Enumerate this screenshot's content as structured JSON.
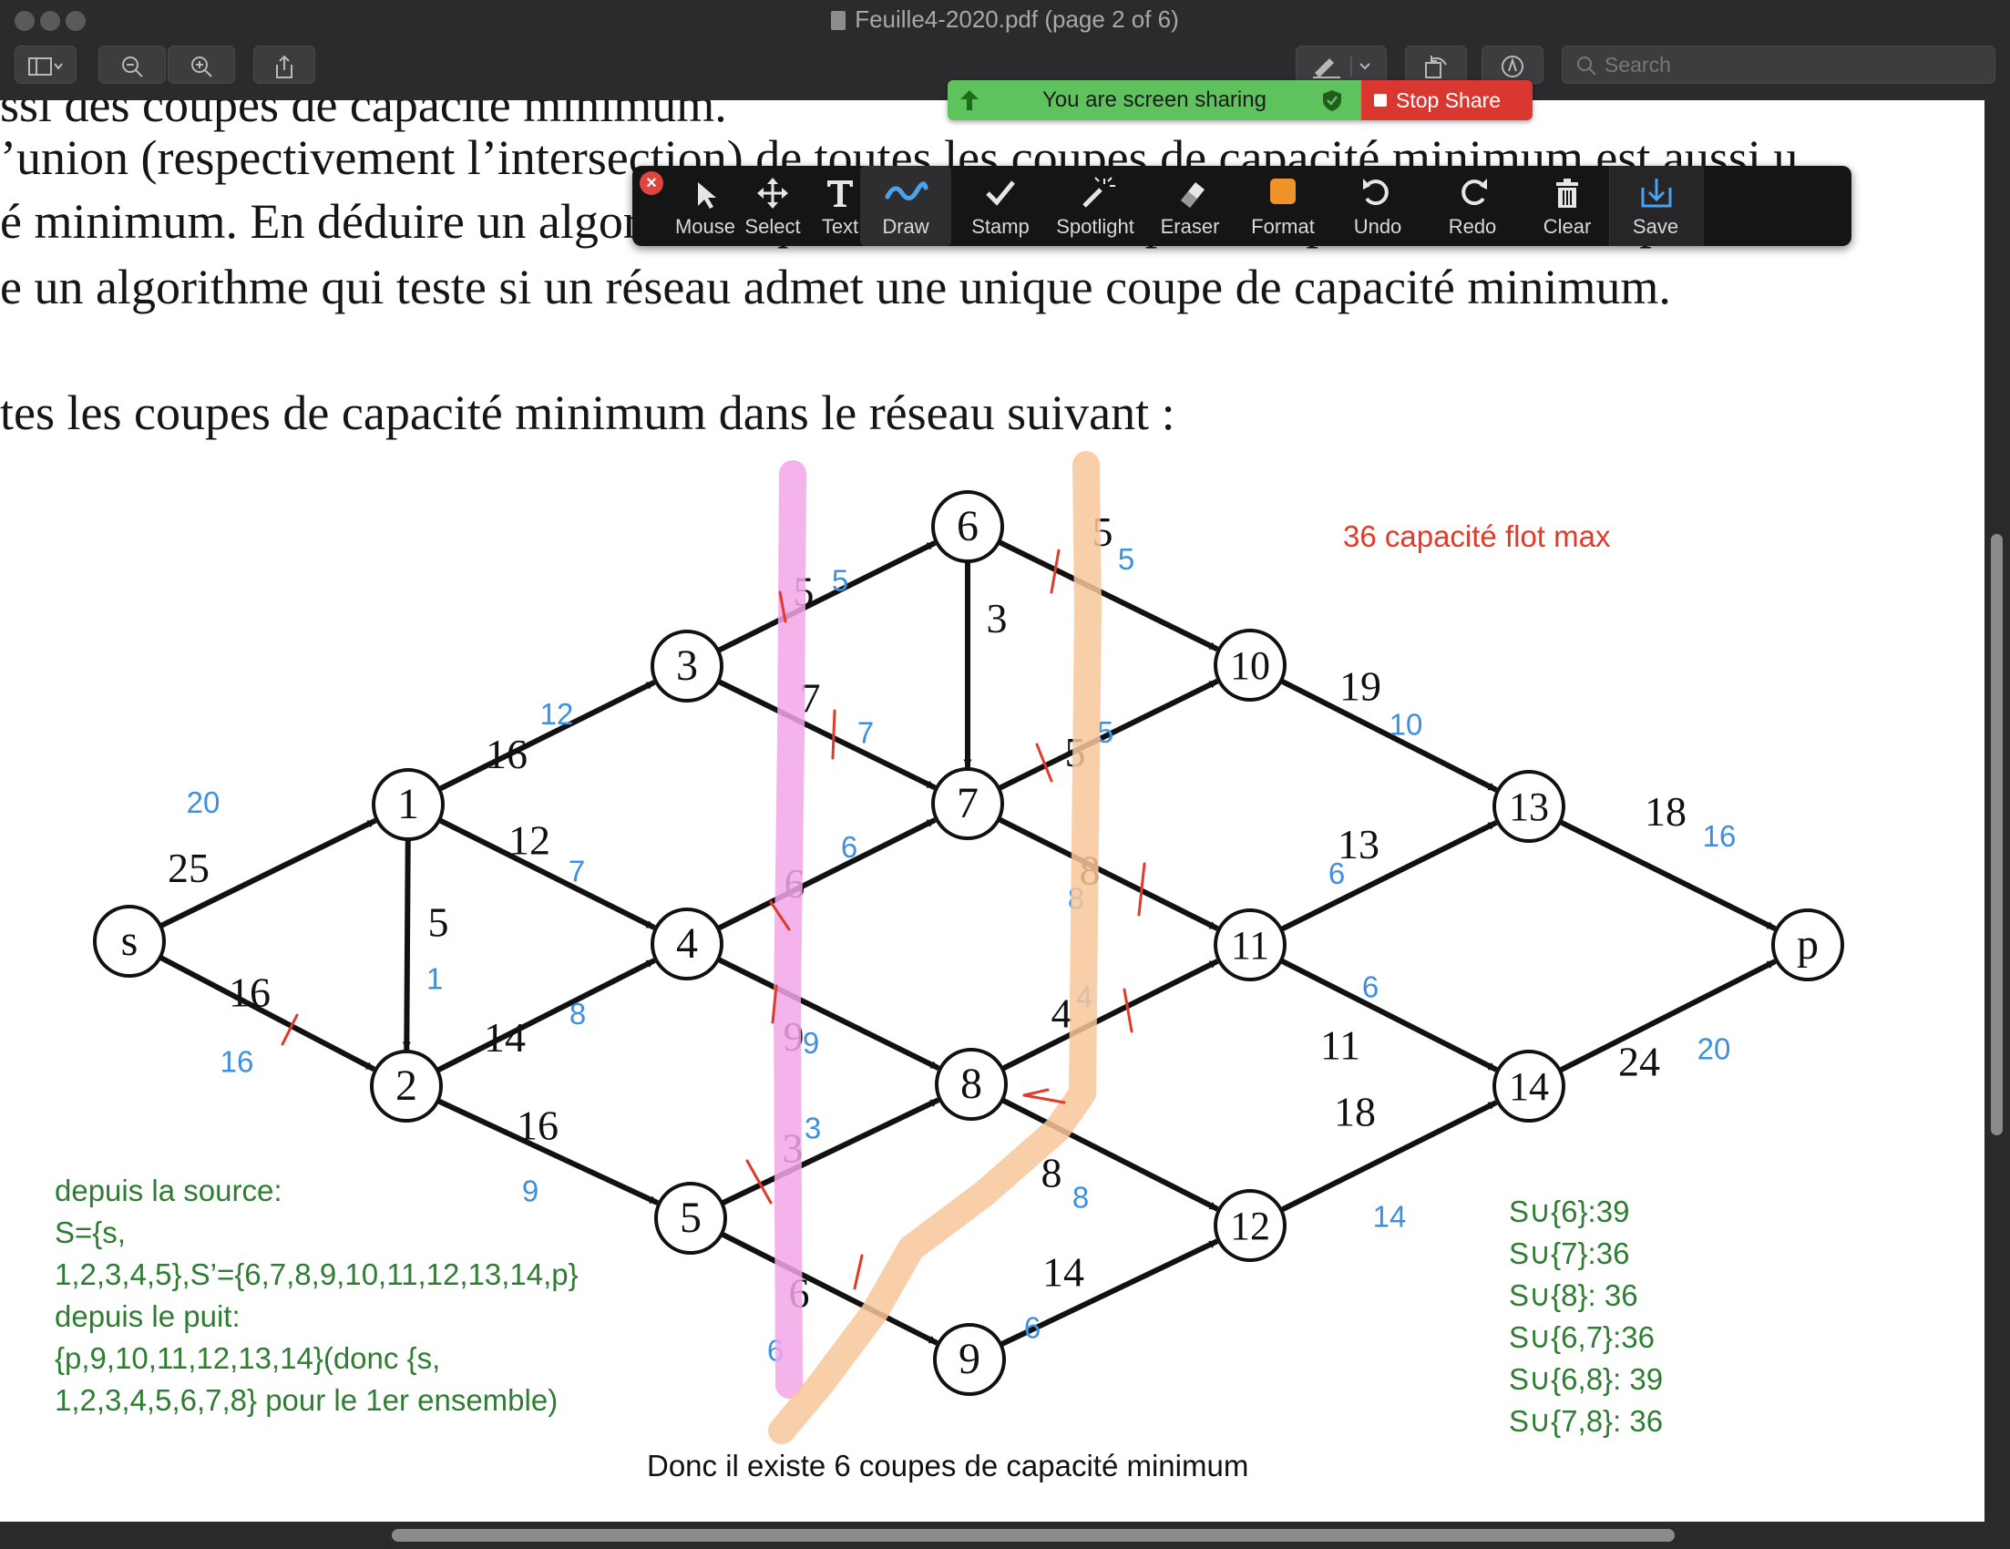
{
  "window": {
    "title": "Feuille4-2020.pdf (page 2 of 6)",
    "search_placeholder": "Search"
  },
  "share": {
    "status": "You are screen sharing",
    "stop_label": "Stop Share"
  },
  "annotation_toolbar": {
    "tools": [
      {
        "label": "Mouse",
        "icon": "cursor-arrow-icon"
      },
      {
        "label": "Select",
        "icon": "move-arrows-icon"
      },
      {
        "label": "Text",
        "icon": "text-T-icon"
      },
      {
        "label": "Draw",
        "icon": "squiggle-icon"
      },
      {
        "label": "Stamp",
        "icon": "checkmark-icon"
      },
      {
        "label": "Spotlight",
        "icon": "magic-wand-icon"
      },
      {
        "label": "Eraser",
        "icon": "eraser-icon"
      },
      {
        "label": "Format",
        "icon": "color-swatch-icon"
      },
      {
        "label": "Undo",
        "icon": "undo-icon"
      },
      {
        "label": "Redo",
        "icon": "redo-icon"
      },
      {
        "label": "Clear",
        "icon": "trash-icon"
      },
      {
        "label": "Save",
        "icon": "save-download-icon"
      }
    ],
    "active_tool": "Draw",
    "format_color": "#f0932b"
  },
  "document": {
    "lines": [
      "ssi des coupes de capacité minimum.",
      "’union (respectivement l’intersection) de toutes les coupes de capacité minimum est aussi u",
      "é minimum. En déduire un algorithme qui calcule une coupe de capacité minimum pour",
      "e un algorithme qui teste si un réseau admet une unique coupe de capacité minimum.",
      "tes les coupes de capacité minimum dans le réseau suivant :"
    ]
  },
  "graph": {
    "nodes": [
      "s",
      "1",
      "2",
      "3",
      "4",
      "5",
      "6",
      "7",
      "8",
      "9",
      "10",
      "11",
      "12",
      "13",
      "14",
      "p"
    ],
    "edges": [
      {
        "from": "s",
        "to": "1",
        "capacity": "25",
        "flow": "20"
      },
      {
        "from": "s",
        "to": "2",
        "capacity": "16",
        "flow": "16"
      },
      {
        "from": "1",
        "to": "2",
        "capacity": "5",
        "flow": "1"
      },
      {
        "from": "1",
        "to": "3",
        "capacity": "16",
        "flow": "12"
      },
      {
        "from": "1",
        "to": "4",
        "capacity": "12",
        "flow": "7"
      },
      {
        "from": "2",
        "to": "4",
        "capacity": "14",
        "flow": "8"
      },
      {
        "from": "2",
        "to": "5",
        "capacity": "16",
        "flow": "9"
      },
      {
        "from": "3",
        "to": "6",
        "capacity": "5",
        "flow": "5"
      },
      {
        "from": "3",
        "to": "7",
        "capacity": "7",
        "flow": "7"
      },
      {
        "from": "4",
        "to": "7",
        "capacity": "6",
        "flow": "6"
      },
      {
        "from": "4",
        "to": "8",
        "capacity": "9",
        "flow": "9"
      },
      {
        "from": "5",
        "to": "8",
        "capacity": "3",
        "flow": "3"
      },
      {
        "from": "5",
        "to": "9",
        "capacity": "6",
        "flow": "6"
      },
      {
        "from": "6",
        "to": "7",
        "capacity": "3",
        "flow": ""
      },
      {
        "from": "6",
        "to": "10",
        "capacity": "5",
        "flow": "5"
      },
      {
        "from": "7",
        "to": "10",
        "capacity": "5",
        "flow": "5"
      },
      {
        "from": "7",
        "to": "11",
        "capacity": "8",
        "flow": "8"
      },
      {
        "from": "8",
        "to": "11",
        "capacity": "4",
        "flow": "4"
      },
      {
        "from": "8",
        "to": "12",
        "capacity": "8",
        "flow": "8"
      },
      {
        "from": "9",
        "to": "12",
        "capacity": "14",
        "flow": "6"
      },
      {
        "from": "10",
        "to": "13",
        "capacity": "19",
        "flow": "10"
      },
      {
        "from": "11",
        "to": "13",
        "capacity": "13",
        "flow": "6"
      },
      {
        "from": "11",
        "to": "14",
        "capacity": "11",
        "flow": "6"
      },
      {
        "from": "12",
        "to": "14",
        "capacity": "18",
        "flow": "14"
      },
      {
        "from": "13",
        "to": "p",
        "capacity": "18",
        "flow": "16"
      },
      {
        "from": "14",
        "to": "p",
        "capacity": "24",
        "flow": "20"
      }
    ]
  },
  "annotations": {
    "max_flow": "36 capacité flot max",
    "source_notes": [
      "depuis la source:",
      "S={s,",
      "1,2,3,4,5},S’={6,7,8,9,10,11,12,13,14,p}",
      "depuis le puit:",
      "{p,9,10,11,12,13,14}(donc {s,",
      "1,2,3,4,5,6,7,8} pour le 1er ensemble)"
    ],
    "cuts": [
      "S∪{6}:39",
      "S∪{7}:36",
      "S∪{8}: 36",
      "S∪{6,7}:36",
      "S∪{6,8}: 39",
      "S∪{7,8}: 36"
    ],
    "conclusion": "Donc il existe 6 coupes de capacité minimum",
    "colors": {
      "flow": "#3f8fe0",
      "red": "#e23a2a",
      "green": "#2e7d32",
      "pink": "#f2a6e6",
      "orange": "#f7c79a"
    }
  }
}
